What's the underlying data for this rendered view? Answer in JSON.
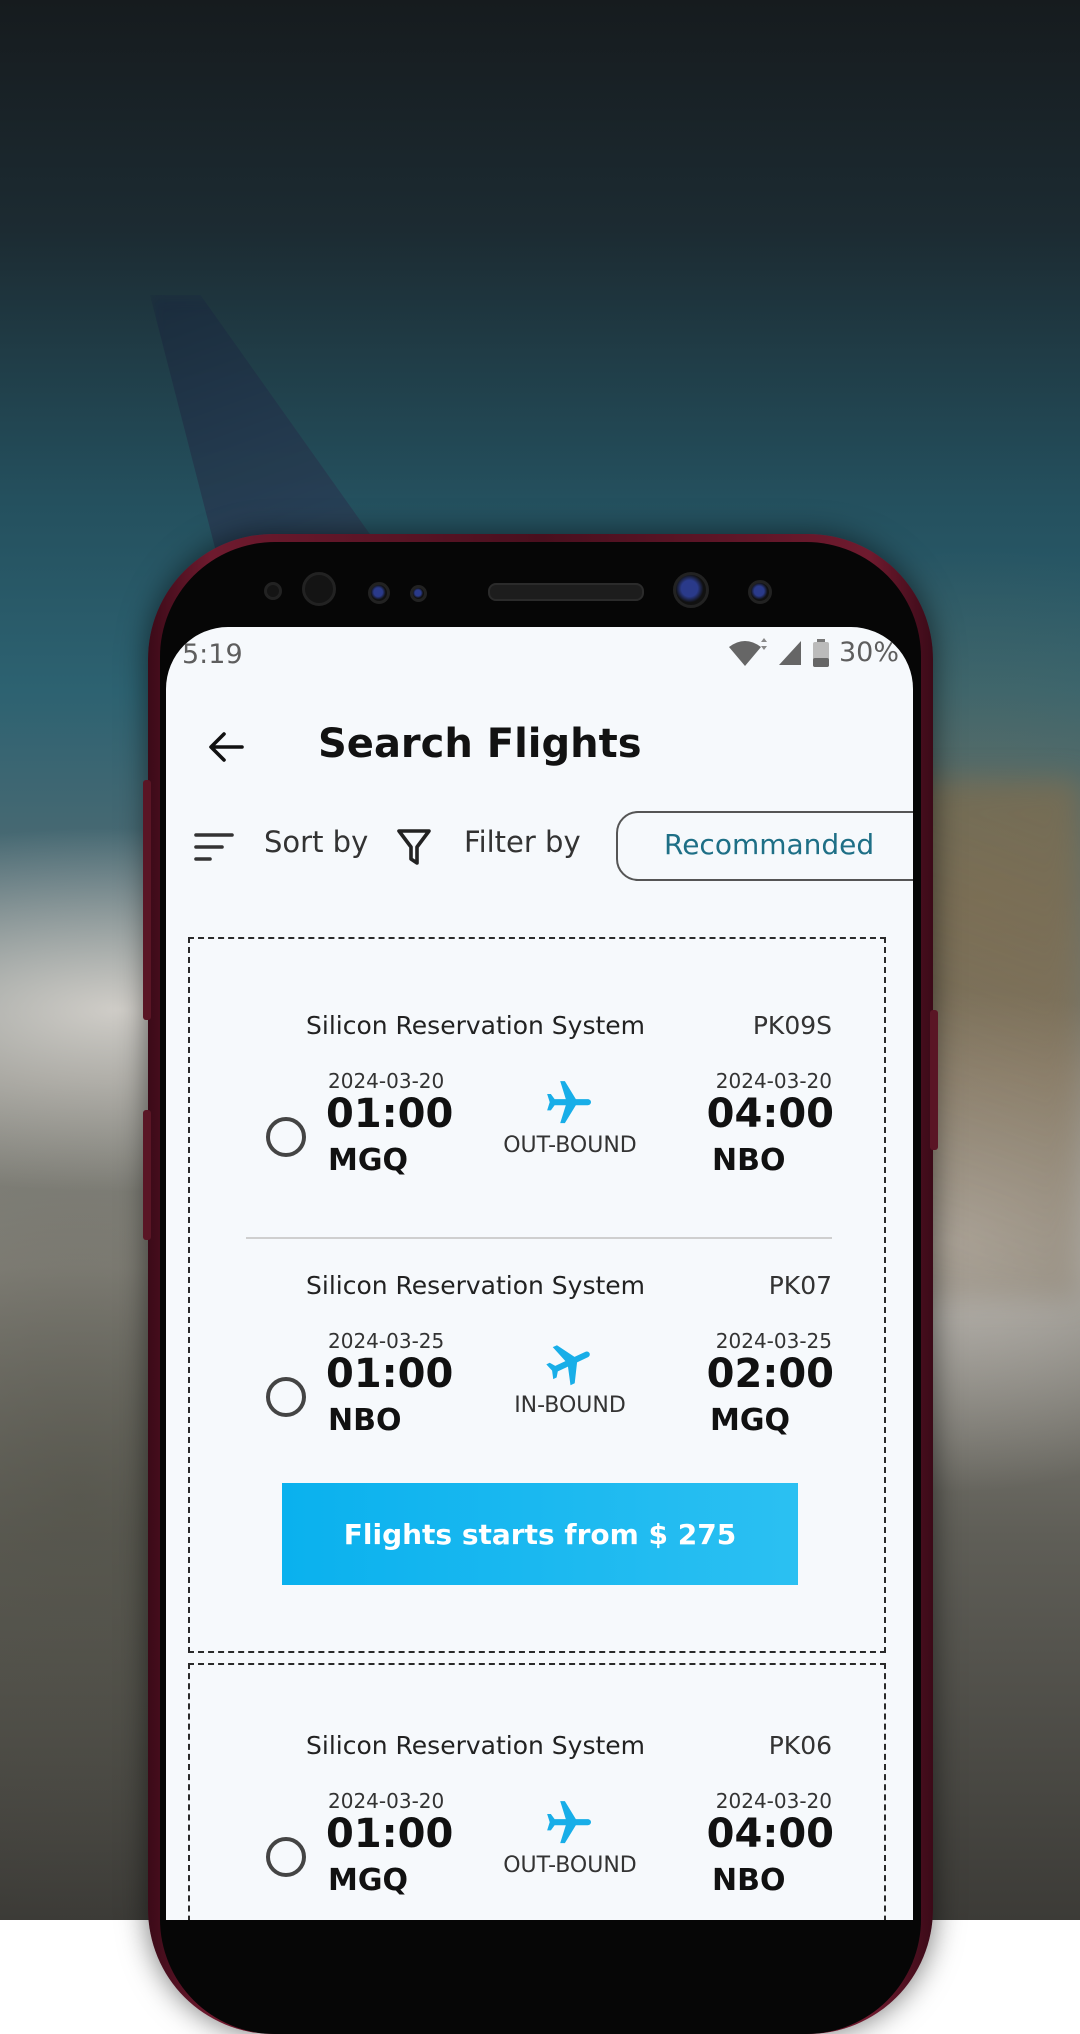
{
  "status_bar": {
    "time": "5:19",
    "battery": "30%"
  },
  "header": {
    "title": "Search Flights"
  },
  "toolbar": {
    "sort_label": "Sort by",
    "filter_label": "Filter by",
    "chip_label": "Recommanded"
  },
  "cards": [
    {
      "legs": [
        {
          "airline": "Silicon Reservation System",
          "code": "PK09S",
          "dep_date": "2024-03-20",
          "dep_time": "01:00",
          "dep_code": "MGQ",
          "direction": "OUT-BOUND",
          "arr_date": "2024-03-20",
          "arr_time": "04:00",
          "arr_code": "NBO"
        },
        {
          "airline": "Silicon Reservation System",
          "code": "PK07",
          "dep_date": "2024-03-25",
          "dep_time": "01:00",
          "dep_code": "NBO",
          "direction": "IN-BOUND",
          "arr_date": "2024-03-25",
          "arr_time": "02:00",
          "arr_code": "MGQ"
        }
      ],
      "price_label": "Flights starts from $ 275"
    },
    {
      "legs": [
        {
          "airline": "Silicon Reservation System",
          "code": "PK06",
          "dep_date": "2024-03-20",
          "dep_time": "01:00",
          "dep_code": "MGQ",
          "direction": "OUT-BOUND",
          "arr_date": "2024-03-20",
          "arr_time": "04:00",
          "arr_code": "NBO"
        }
      ]
    }
  ],
  "colors": {
    "accent": "#0ab1ee",
    "chip_text": "#1e6f86",
    "phone_frame": "#6e1a2e"
  }
}
